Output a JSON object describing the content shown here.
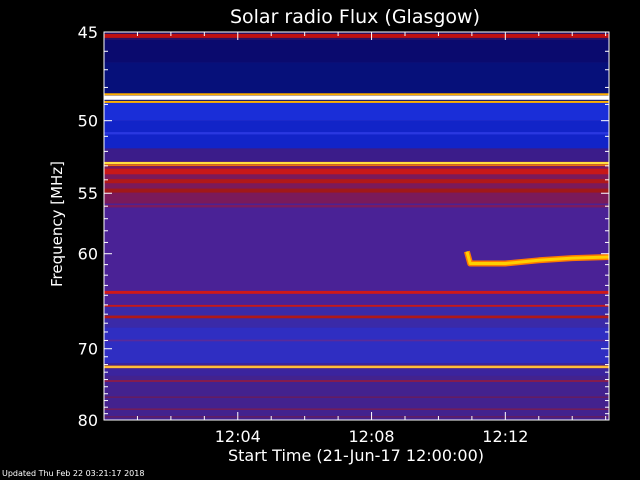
{
  "chart_data": {
    "type": "heatmap",
    "title": "Solar radio Flux (Glasgow)",
    "xlabel": "Start Time (21-Jun-17 12:00:00)",
    "ylabel": "Frequency [MHz]",
    "x_range_minutes": [
      0,
      15.1
    ],
    "y_range_mhz": [
      45,
      80
    ],
    "y_scale": "reciprocal",
    "x_ticks": [
      {
        "minute": 4,
        "label": "12:04"
      },
      {
        "minute": 8,
        "label": "12:08"
      },
      {
        "minute": 12,
        "label": "12:12"
      }
    ],
    "y_ticks": [
      {
        "mhz": 45,
        "label": "45"
      },
      {
        "mhz": 50,
        "label": "50"
      },
      {
        "mhz": 55,
        "label": "55"
      },
      {
        "mhz": 60,
        "label": "60"
      },
      {
        "mhz": 70,
        "label": "70"
      },
      {
        "mhz": 80,
        "label": "80"
      }
    ],
    "background_bands": [
      {
        "f0": 45.0,
        "f1": 45.4,
        "color": "#2a1060"
      },
      {
        "f0": 45.4,
        "f1": 46.6,
        "color": "#0a0a6e"
      },
      {
        "f0": 46.6,
        "f1": 48.8,
        "color": "#06107a"
      },
      {
        "f0": 48.8,
        "f1": 50.0,
        "color": "#1a2ed8"
      },
      {
        "f0": 50.0,
        "f1": 51.8,
        "color": "#1224c8"
      },
      {
        "f0": 51.8,
        "f1": 52.7,
        "color": "#3b1c8a"
      },
      {
        "f0": 52.7,
        "f1": 55.8,
        "color": "#7a1a5a"
      },
      {
        "f0": 55.8,
        "f1": 65.0,
        "color": "#4a2296"
      },
      {
        "f0": 65.0,
        "f1": 67.5,
        "color": "#3a2aa8"
      },
      {
        "f0": 67.5,
        "f1": 71.8,
        "color": "#2f2ec2"
      },
      {
        "f0": 71.8,
        "f1": 73.5,
        "color": "#3b249e"
      },
      {
        "f0": 73.5,
        "f1": 80.0,
        "color": "#43228e"
      }
    ],
    "lines": [
      {
        "f": 45.2,
        "w": 0.2,
        "color": "#c01010"
      },
      {
        "f": 48.6,
        "w": 0.25,
        "color": "#ffffff"
      },
      {
        "f": 48.4,
        "w": 0.12,
        "color": "#ffb000"
      },
      {
        "f": 48.85,
        "w": 0.12,
        "color": "#ffb000"
      },
      {
        "f": 50.8,
        "w": 0.15,
        "color": "#2a38e0"
      },
      {
        "f": 52.8,
        "w": 0.15,
        "color": "#ffe040"
      },
      {
        "f": 52.95,
        "w": 0.1,
        "color": "#ff8000"
      },
      {
        "f": 53.4,
        "w": 0.4,
        "color": "#c81818"
      },
      {
        "f": 54.1,
        "w": 0.3,
        "color": "#b01818"
      },
      {
        "f": 54.8,
        "w": 0.3,
        "color": "#a01818"
      },
      {
        "f": 56.0,
        "w": 0.2,
        "color": "#7a1c60"
      },
      {
        "f": 63.7,
        "w": 0.3,
        "color": "#d01818"
      },
      {
        "f": 65.1,
        "w": 0.2,
        "color": "#c81818"
      },
      {
        "f": 66.3,
        "w": 0.3,
        "color": "#b01818"
      },
      {
        "f": 69.0,
        "w": 0.2,
        "color": "#5a2a9a"
      },
      {
        "f": 72.3,
        "w": 0.35,
        "color": "#ff8c00"
      },
      {
        "f": 72.3,
        "w": 0.12,
        "color": "#ffe060"
      },
      {
        "f": 74.2,
        "w": 0.25,
        "color": "#8a1c48"
      },
      {
        "f": 76.5,
        "w": 0.2,
        "color": "#6a1c5a"
      },
      {
        "f": 78.3,
        "w": 0.2,
        "color": "#7a1c52"
      },
      {
        "f": 79.5,
        "w": 0.2,
        "color": "#6a1c5a"
      }
    ],
    "burst": {
      "series": [
        {
          "minute": 10.85,
          "mhz": 59.8
        },
        {
          "minute": 10.95,
          "mhz": 60.9
        },
        {
          "minute": 12.0,
          "mhz": 60.9
        },
        {
          "minute": 13.0,
          "mhz": 60.6
        },
        {
          "minute": 14.0,
          "mhz": 60.4
        },
        {
          "minute": 15.1,
          "mhz": 60.3
        }
      ],
      "color": "#ffd000"
    }
  },
  "footer": "Updated Thu Feb 22 03:21:17 2018"
}
